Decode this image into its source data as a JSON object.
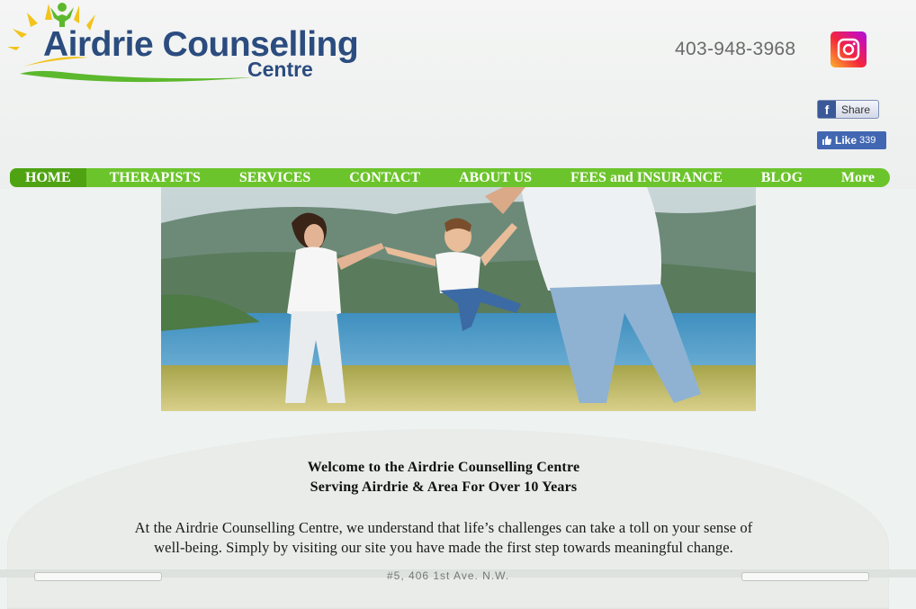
{
  "logo": {
    "main": "Airdrie Counselling",
    "sub": "Centre"
  },
  "contact": {
    "phone": "403-948-3968"
  },
  "social": {
    "instagram_icon": "instagram-icon",
    "facebook_share_label": "Share",
    "facebook_like_label": "Like",
    "facebook_like_count": "339"
  },
  "nav": {
    "items": [
      {
        "label": "HOME"
      },
      {
        "label": "THERAPISTS"
      },
      {
        "label": "SERVICES"
      },
      {
        "label": "CONTACT"
      },
      {
        "label": "ABOUT US"
      },
      {
        "label": "FEES and INSURANCE"
      },
      {
        "label": "BLOG"
      },
      {
        "label": "More"
      }
    ],
    "active": "HOME"
  },
  "main": {
    "welcome_line1": "Welcome to the Airdrie Counselling Centre",
    "welcome_line2": "Serving Airdrie & Area For Over 10 Years",
    "intro_line1": "At the Airdrie Counselling Centre, we understand that life’s challenges can take a toll on your sense of",
    "intro_line2": "well-being. Simply by visiting our site you have made the first step towards meaningful change."
  },
  "footer": {
    "address_partial": "#5, 406 1st Ave. N.W."
  },
  "colors": {
    "nav_green": "#6cc42c",
    "nav_active": "#4fa312",
    "logo_blue": "#2b4c7e",
    "logo_green": "#5cb82d"
  }
}
